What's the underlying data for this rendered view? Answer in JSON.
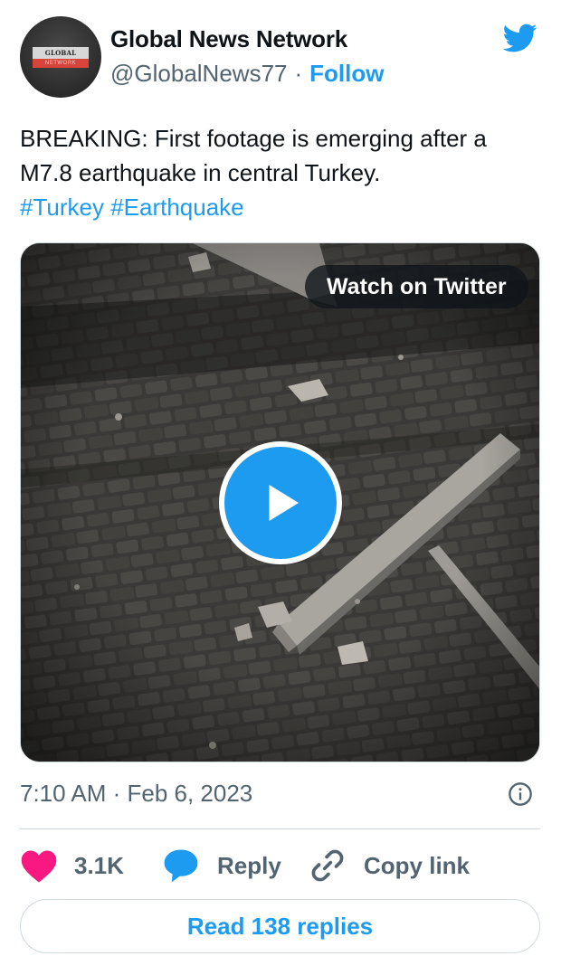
{
  "account": {
    "name": "Global News Network",
    "handle": "@GlobalNews77",
    "separator": "·",
    "follow_label": "Follow",
    "avatar_logo_top": "GLOBAL NEWS",
    "avatar_logo_bottom": "NETWORK"
  },
  "tweet": {
    "text_line1": "BREAKING: First footage is emerging after a",
    "text_line2": "M7.8 earthquake in central Turkey.",
    "hashtags": [
      "#Turkey",
      "#Earthquake"
    ]
  },
  "media": {
    "watch_label": "Watch on Twitter"
  },
  "meta": {
    "timestamp": "7:10 AM · Feb 6, 2023"
  },
  "actions": {
    "like_count": "3.1K",
    "reply_label": "Reply",
    "copy_link_label": "Copy link"
  },
  "read_replies_label": "Read 138 replies",
  "colors": {
    "accent": "#1d9bf0",
    "like": "#f91880",
    "muted_text": "#536471"
  },
  "icons": [
    "twitter-bird-icon",
    "play-icon",
    "heart-icon",
    "speech-bubble-icon",
    "link-icon",
    "info-icon"
  ]
}
